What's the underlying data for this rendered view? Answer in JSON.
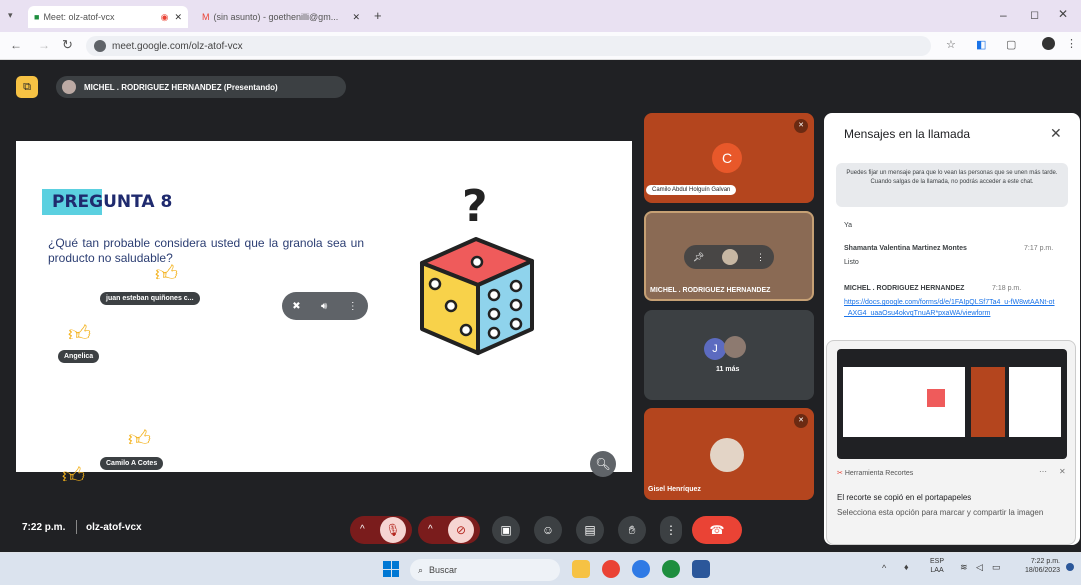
{
  "browser": {
    "tabs": [
      {
        "label": "Meet: olz-atof-vcx"
      },
      {
        "label": "(sin asunto) - goethenilli@gm..."
      }
    ],
    "url": "meet.google.com/olz-atof-vcx"
  },
  "meet": {
    "presenter_label": "MICHEL . RODRIGUEZ HERNANDEZ (Presentando)",
    "slide": {
      "title": "PREGUNTA 8",
      "question": "¿Qué tan probable considera usted que la granola sea un producto no saludable?"
    },
    "reactions": [
      {
        "name": "juan esteban quiñones c..."
      },
      {
        "name": "Angelica"
      },
      {
        "name": "Camilo A Cotes"
      }
    ],
    "tiles": [
      {
        "name": "Camilo Abdul Holguín Galvan",
        "initial": "C"
      },
      {
        "name": "MICHEL . RODRIGUEZ HERNANDEZ"
      },
      {
        "name": "11 más",
        "initial": "J"
      },
      {
        "name": "Gisel Henríquez"
      }
    ],
    "time": "7:22 p.m.",
    "meeting_code": "olz-atof-vcx"
  },
  "chat": {
    "title": "Mensajes en la llamada",
    "info": "Puedes fijar un mensaje para que lo vean las personas que se unen más tarde. Cuando salgas de la llamada, no podrás acceder a este chat.",
    "messages": [
      {
        "text": "Ya"
      },
      {
        "sender": "Shamanta Valentina Martinez Montes",
        "time": "7:17 p.m.",
        "text": "Listo"
      },
      {
        "sender": "MICHEL . RODRIGUEZ HERNANDEZ",
        "time": "7:18 p.m.",
        "text": "https://docs.google.com/forms/d/e/1FAIpQLSf7Ta4_u-fW8wtAANt-ot_AXG4_uaaOsu4okvqTnuAR*pxaWA/viewform"
      }
    ]
  },
  "snip": {
    "app": "Herramienta Recortes",
    "title": "El recorte se copió en el portapapeles",
    "body": "Selecciona esta opción para marcar y compartir la imagen"
  },
  "taskbar": {
    "search": "Buscar",
    "lang": "ESP",
    "lang2": "LAA",
    "time": "7:22 p.m.",
    "date": "18/06/2023"
  },
  "colors": {
    "meet_bg": "#202124",
    "accent_red": "#ea4335",
    "slide_teal": "#5bd0e0"
  }
}
